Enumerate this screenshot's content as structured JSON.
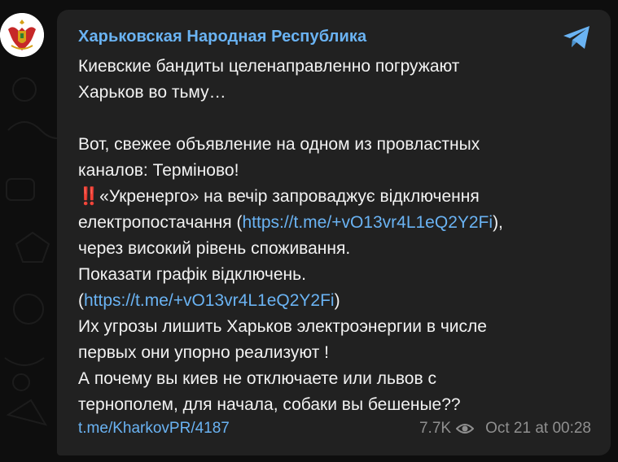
{
  "channel": {
    "name": "Харьковская Народная Республика",
    "avatar_icon": "coat-of-arms-icon",
    "share_icon": "telegram-share-icon"
  },
  "message": {
    "lines": [
      "Киевские бандиты целенаправленно погружают",
      "Харьков во тьму…",
      "",
      "Вот, свежее объявление на одном из провластных",
      "каналов: Терміново!"
    ],
    "emoji": "‼️",
    "quote_line1": "«Укренерго» на вечір запроваджує відключення",
    "quote_line2_text": "електропостачання (",
    "link1": "https://t.me/+vO13vr4L1eQ2Y2Fi",
    "quote_line2_suffix": "),",
    "quote_line3": "через високий рівень споживання.",
    "quote_line4": "Показати графік відключень.",
    "quote_line5_prefix": "(",
    "link2": "https://t.me/+vO13vr4L1eQ2Y2Fi",
    "quote_line5_suffix": ")",
    "tail_lines": [
      "Их угрозы лишить Харьков электроэнергии в числе",
      "первых они упорно реализуют !",
      "А почему вы киев не отключаете или львов с",
      "тернополем, для начала, собаки вы бешеные??"
    ]
  },
  "footer": {
    "post_link": "t.me/KharkovPR/4187",
    "views": "7.7K",
    "views_icon": "eye-icon",
    "timestamp": "Oct 21 at 00:28"
  },
  "colors": {
    "background": "#0e0e0e",
    "bubble": "#212121",
    "accent": "#6ab3f3",
    "text": "#f2f2f2",
    "muted": "#8f8f8f",
    "emoji_red": "#e53935"
  }
}
